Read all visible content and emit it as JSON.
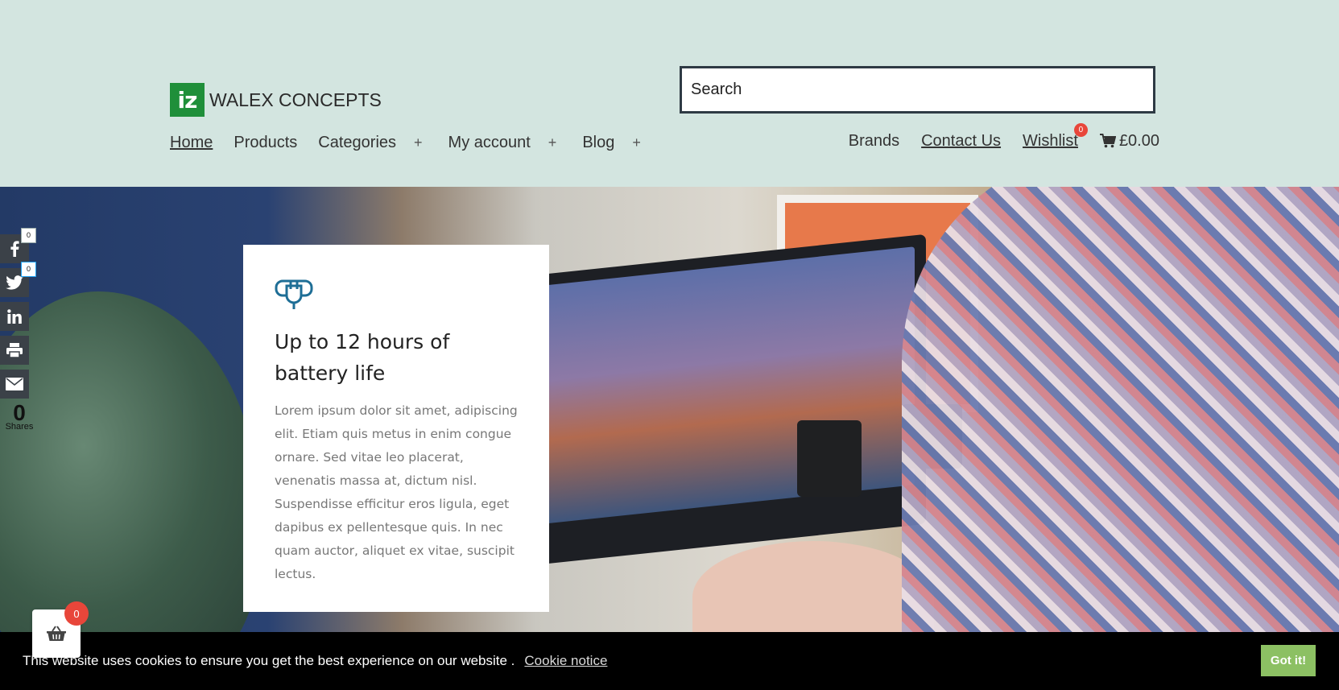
{
  "brand": {
    "mark": "iz",
    "name": "WALEX CONCEPTS",
    "mark_color": "#1f8f3a"
  },
  "search": {
    "placeholder": "Search"
  },
  "main_nav": {
    "home": "Home",
    "products": "Products",
    "categories": "Categories",
    "my_account": "My account",
    "blog": "Blog",
    "expand_glyph": "+"
  },
  "right_nav": {
    "brands": "Brands",
    "contact": "Contact Us",
    "wishlist": "Wishlist",
    "wishlist_count": "0",
    "cart_total": "£0.00"
  },
  "feature": {
    "icon": "plug-icon",
    "title": "Up to 12 hours of battery life",
    "body": "Lorem ipsum dolor sit amet, adipiscing elit. Etiam quis metus in enim congue ornare. Sed vitae leo placerat, venenatis massa at, dictum nisl. Suspendisse efficitur eros ligula, eget dapibus ex pellentesque quis. In nec quam auctor, aliquet ex vitae, suscipit lectus."
  },
  "social": {
    "facebook_count": "0",
    "twitter_count": "0",
    "total_shares": "0",
    "shares_label": "Shares"
  },
  "cookie": {
    "message": "This website uses cookies to ensure you get the best experience on our website .",
    "link": "Cookie notice",
    "button": "Got it!"
  },
  "basket": {
    "count": "0"
  },
  "colors": {
    "header_bg": "#d3e5e0",
    "accent_red": "#e8463a",
    "cookie_button": "#8cc063",
    "icon_blue": "#1e6e96"
  }
}
